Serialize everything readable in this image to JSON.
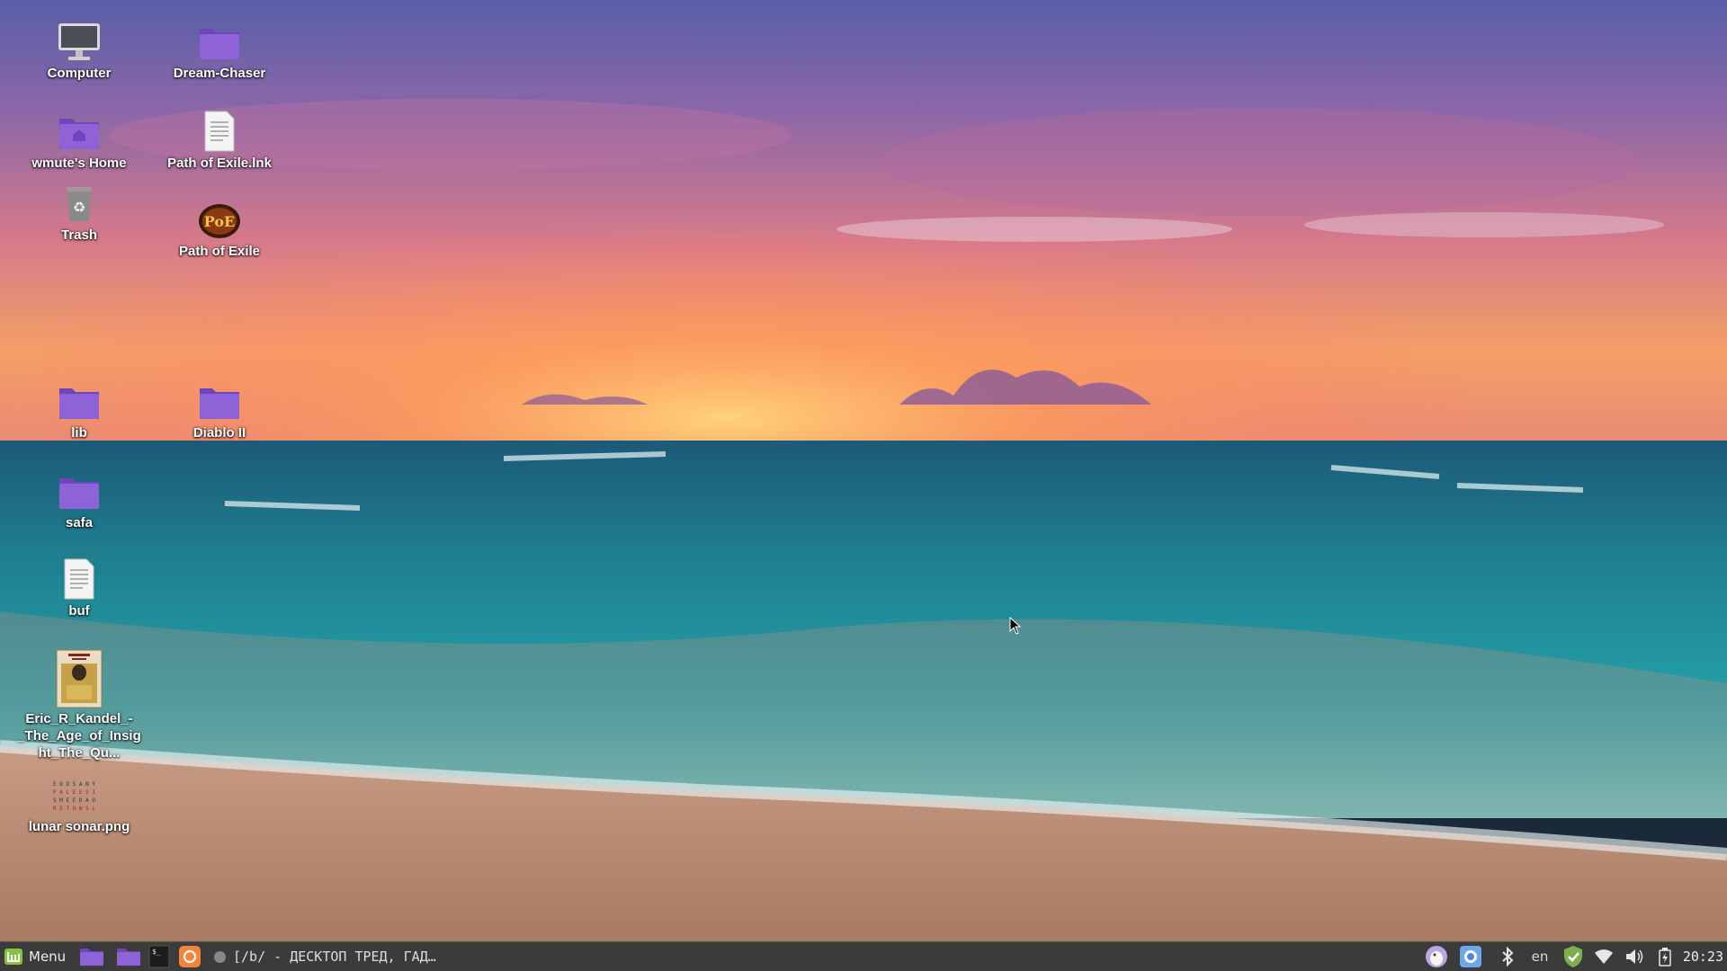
{
  "desktop": {
    "icons": [
      {
        "label": "Computer",
        "icon": "computer-icon"
      },
      {
        "label": "Dream-Chaser",
        "icon": "folder-icon"
      },
      {
        "label": "wmute's Home",
        "icon": "home-folder-icon"
      },
      {
        "label": "Path of Exile.lnk",
        "icon": "text-file-icon"
      },
      {
        "label": "Trash",
        "icon": "trash-icon"
      },
      {
        "label": "Path of Exile",
        "icon": "poe-game-icon"
      },
      {
        "label": "lib",
        "icon": "folder-icon"
      },
      {
        "label": "Diablo II",
        "icon": "folder-icon"
      },
      {
        "label": "safa",
        "icon": "folder-icon"
      },
      {
        "label": "buf",
        "icon": "text-file-icon"
      },
      {
        "label": "Eric_R_Kandel_-_The_Age_of_Insight_The_Qu...",
        "icon": "book-cover-thumbnail"
      },
      {
        "label": "lunar sonar.png",
        "icon": "image-thumbnail"
      }
    ],
    "colors": {
      "folder": "#8e63d8",
      "folder_dark": "#6f45bb"
    }
  },
  "taskbar": {
    "menu_label": "Menu",
    "launchers": [
      "folder-icon",
      "folder-icon",
      "terminal-icon",
      "firefox-icon"
    ],
    "window_title": "[/b/ - ДЕСКТОП ТРЕД, ГАД…",
    "tray": [
      "pidgin-icon",
      "chromium-icon",
      "bluetooth-icon",
      "keyboard-layout",
      "shield-check-icon",
      "wifi-icon",
      "volume-icon",
      "battery-icon"
    ],
    "language": "en",
    "clock": "20:23",
    "colors": {
      "bg": "#3b3b3b",
      "mint_green": "#87c043"
    }
  }
}
